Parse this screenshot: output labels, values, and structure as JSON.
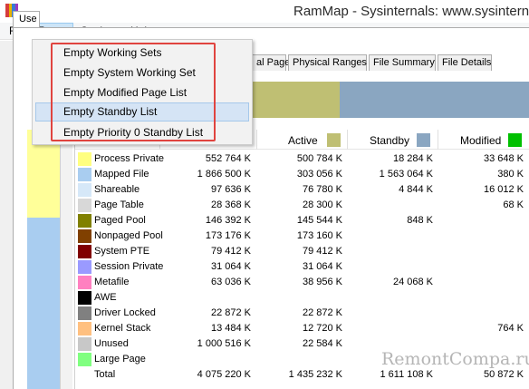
{
  "window": {
    "title": "RamMap - Sysinternals: www.sysinternals"
  },
  "menu": {
    "file": "File",
    "empty": "Empty",
    "settings": "Settings",
    "help": "Help"
  },
  "dropdown": [
    "Empty Working Sets",
    "Empty System Working Set",
    "Empty Modified Page List",
    "Empty Standby List",
    "Empty Priority 0 Standby List"
  ],
  "left_tab": "Use",
  "tabs": [
    "al Pages",
    "Physical Ranges",
    "File Summary",
    "File Details"
  ],
  "columns": {
    "active": "Active",
    "standby": "Standby",
    "modified": "Modified"
  },
  "column_colors": {
    "active": "#bfbf73",
    "standby": "#8aa6c1",
    "modified": "#00c000"
  },
  "topbar_colors": {
    "active": "#bfbf73",
    "standby": "#8aa6c1"
  },
  "rows": [
    {
      "label": "Process Private",
      "color": "#ffff80",
      "total": "552 764 K",
      "active": "500 784 K",
      "standby": "18 284 K",
      "modified": "33 648 K"
    },
    {
      "label": "Mapped File",
      "color": "#a9cdf0",
      "total": "1 866 500 K",
      "active": "303 056 K",
      "standby": "1 563 064 K",
      "modified": "380 K"
    },
    {
      "label": "Shareable",
      "color": "#d6e8f8",
      "total": "97 636 K",
      "active": "76 780 K",
      "standby": "4 844 K",
      "modified": "16 012 K"
    },
    {
      "label": "Page Table",
      "color": "#d8d8d8",
      "total": "28 368 K",
      "active": "28 300 K",
      "standby": "",
      "modified": "68 K"
    },
    {
      "label": "Paged Pool",
      "color": "#808000",
      "total": "146 392 K",
      "active": "145 544 K",
      "standby": "848 K",
      "modified": ""
    },
    {
      "label": "Nonpaged Pool",
      "color": "#804000",
      "total": "173 176 K",
      "active": "173 160 K",
      "standby": "",
      "modified": ""
    },
    {
      "label": "System PTE",
      "color": "#800000",
      "total": "79 412 K",
      "active": "79 412 K",
      "standby": "",
      "modified": ""
    },
    {
      "label": "Session Private",
      "color": "#9a9aff",
      "total": "31 064 K",
      "active": "31 064 K",
      "standby": "",
      "modified": ""
    },
    {
      "label": "Metafile",
      "color": "#ff80c0",
      "total": "63 036 K",
      "active": "38 956 K",
      "standby": "24 068 K",
      "modified": ""
    },
    {
      "label": "AWE",
      "color": "#000000",
      "total": "",
      "active": "",
      "standby": "",
      "modified": ""
    },
    {
      "label": "Driver Locked",
      "color": "#808080",
      "total": "22 872 K",
      "active": "22 872 K",
      "standby": "",
      "modified": ""
    },
    {
      "label": "Kernel Stack",
      "color": "#ffc080",
      "total": "13 484 K",
      "active": "12 720 K",
      "standby": "",
      "modified": "764 K"
    },
    {
      "label": "Unused",
      "color": "#c8c8c8",
      "total": "1 000 516 K",
      "active": "22 584 K",
      "standby": "",
      "modified": ""
    },
    {
      "label": "Large Page",
      "color": "#80ff80",
      "total": "",
      "active": "",
      "standby": "",
      "modified": ""
    },
    {
      "label": "Total",
      "color": "",
      "total": "4 075 220 K",
      "active": "1 435 232 K",
      "standby": "1 611 108 K",
      "modified": "50 872 K"
    }
  ],
  "watermark": "RemontCompa.ru"
}
